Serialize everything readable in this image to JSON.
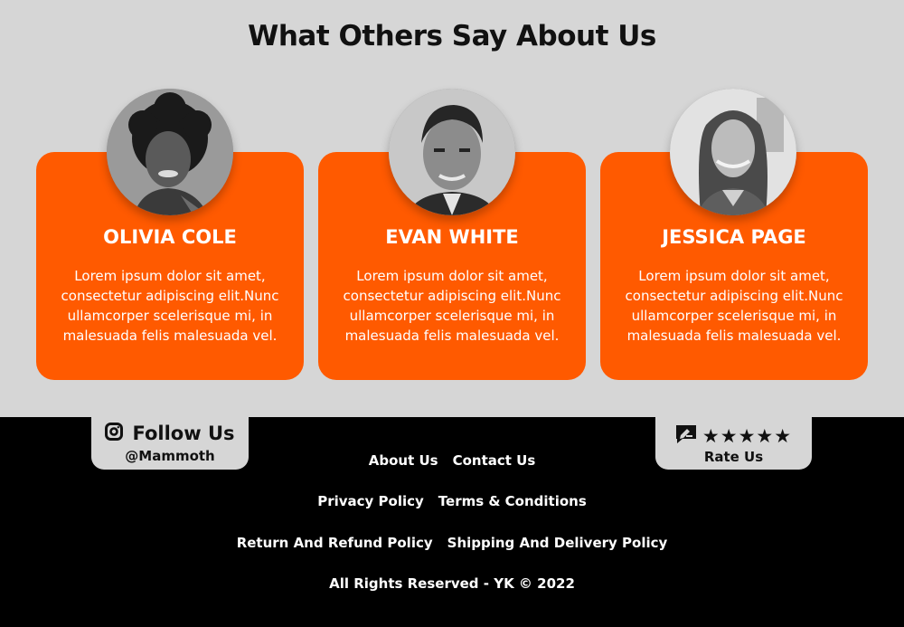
{
  "heading": "What Others Say About Us",
  "testimonials": [
    {
      "name": "OLIVIA COLE",
      "text": "Lorem ipsum dolor sit amet, consectetur adipiscing elit.Nunc ullamcorper scelerisque mi, in malesuada felis malesuada vel."
    },
    {
      "name": "EVAN WHITE",
      "text": "Lorem ipsum dolor sit amet, consectetur adipiscing elit.Nunc ullamcorper scelerisque mi, in malesuada felis malesuada vel."
    },
    {
      "name": "JESSICA PAGE",
      "text": "Lorem ipsum dolor sit amet, consectetur adipiscing elit.Nunc ullamcorper scelerisque mi, in malesuada felis malesuada vel."
    }
  ],
  "follow": {
    "label": "Follow Us",
    "handle": "@Mammoth",
    "icon": "instagram-icon"
  },
  "rate": {
    "stars": "★★★★★",
    "label": "Rate Us",
    "icon": "review-icon",
    "star_count": 5
  },
  "footer": {
    "links_row1": [
      "About Us",
      "Contact Us"
    ],
    "links_row2": [
      "Privacy Policy",
      "Terms & Conditions"
    ],
    "links_row3": [
      "Return And Refund Policy",
      "Shipping And Delivery Policy"
    ],
    "copyright": "All Rights Reserved - YK © 2022"
  },
  "colors": {
    "accent": "#ff5a00",
    "background": "#d6d6d6",
    "footer": "#000000"
  }
}
